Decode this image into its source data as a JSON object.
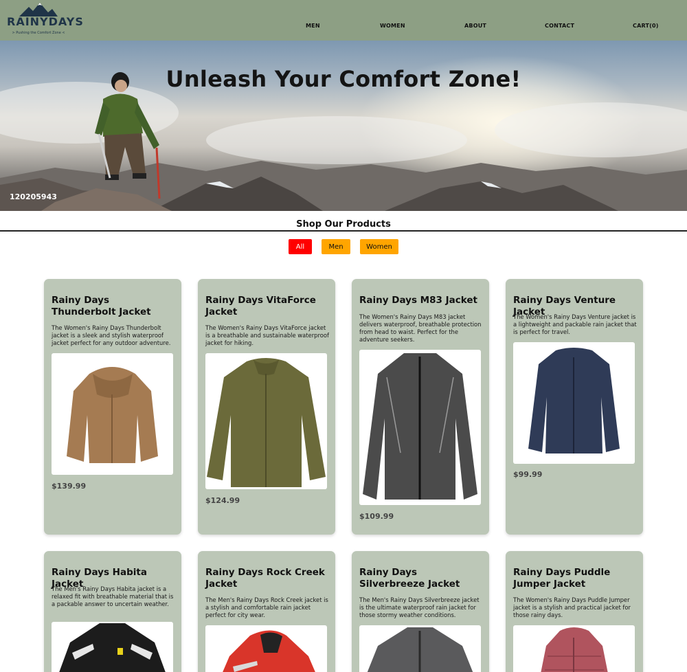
{
  "header": {
    "logo_text": "RAINYDAYS",
    "logo_tagline": "> Pushing the Comfort Zone <",
    "nav": [
      "MEN",
      "WOMEN",
      "ABOUT",
      "CONTACT",
      "CART(0)"
    ]
  },
  "hero": {
    "title": "Unleash Your Comfort Zone!",
    "image_id": "120205943"
  },
  "shop": {
    "title": "Shop Our Products",
    "filters": [
      "All",
      "Men",
      "Women"
    ],
    "active_filter": "All"
  },
  "products": [
    {
      "name": "Rainy Days Thunderbolt Jacket",
      "description": "The Women's Rainy Days Thunderbolt jacket is a sleek and stylish waterproof jacket perfect for any outdoor adventure.",
      "price": "$139.99",
      "image": "fleece-jacket-brown-icon",
      "color": "#a57b52"
    },
    {
      "name": "Rainy Days VitaForce Jacket",
      "description": "The Women's Rainy Days VitaForce jacket is a breathable and sustainable waterproof jacket for hiking.",
      "price": "$124.99",
      "image": "fleece-jacket-olive-icon",
      "color": "#6b6a3a"
    },
    {
      "name": "Rainy Days M83 Jacket",
      "description": "The Women's Rainy Days M83 jacket delivers waterproof, breathable protection from head to waist. Perfect for the adventure seekers.",
      "price": "$109.99",
      "image": "rain-jacket-grey-icon",
      "color": "#4b4b4b"
    },
    {
      "name": "Rainy Days Venture Jacket",
      "description": "The Women's Rainy Days Venture jacket is a lightweight and packable rain jacket that is perfect for travel.",
      "price": "$99.99",
      "image": "fleece-jacket-navy-icon",
      "color": "#2f3b57"
    },
    {
      "name": "Rainy Days Habita Jacket",
      "description": "The Men's Rainy Days Habita jacket is a relaxed fit with breathable material that is a packable answer to uncertain weather.",
      "price": "",
      "image": "ski-jacket-black-icon",
      "color": "#1c1c1c"
    },
    {
      "name": "Rainy Days Rock Creek Jacket",
      "description": "The Men's Rainy Days Rock Creek jacket is a stylish and comfortable rain jacket perfect for city wear.",
      "price": "",
      "image": "rain-jacket-red-icon",
      "color": "#d9352a"
    },
    {
      "name": "Rainy Days Silverbreeze Jacket",
      "description": "The Men's Rainy Days Silverbreeze jacket is the ultimate waterproof rain jacket for those stormy weather conditions.",
      "price": "",
      "image": "rain-jacket-charcoal-icon",
      "color": "#5a5a5c"
    },
    {
      "name": "Rainy Days Puddle Jumper Jacket",
      "description": "The Women's Rainy Days Puddle Jumper jacket is a stylish and practical jacket for those rainy days.",
      "price": "",
      "image": "puffer-jacket-rose-icon",
      "color": "#b0545e"
    }
  ],
  "colors": {
    "header_bg": "#8d9f84",
    "card_bg": "#bcc7b7",
    "filter_active": "#ff0000",
    "filter_inactive": "#ffa500"
  }
}
